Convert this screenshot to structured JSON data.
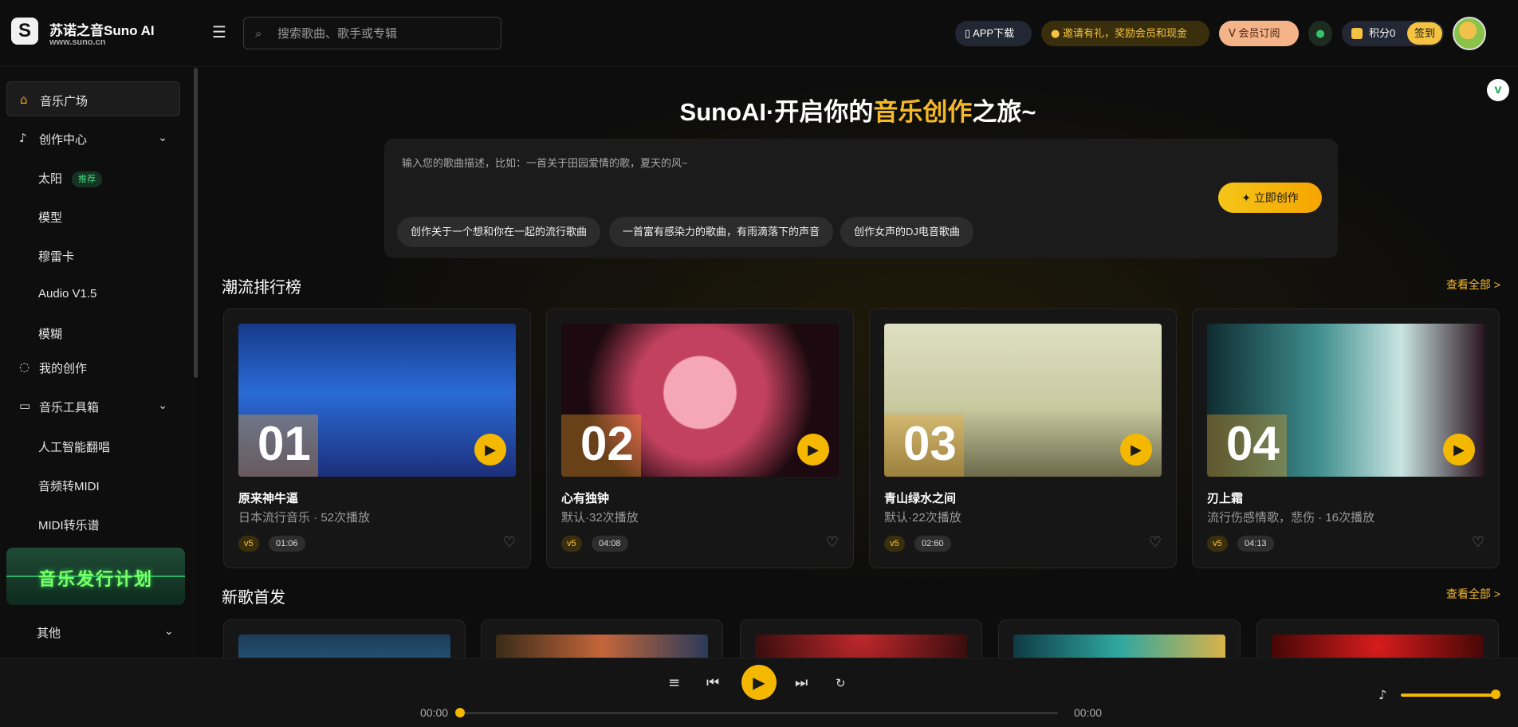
{
  "brand": {
    "name": "苏诺之音Suno AI",
    "domain": "www.suno.cn",
    "logo_letter": "S"
  },
  "header": {
    "search_placeholder": "搜索歌曲、歌手或专辑",
    "app_download": "APP下载",
    "invite": "邀请有礼，奖励会员和现金",
    "vip": "会员订阅",
    "points": "积分0",
    "sign_in": "签到"
  },
  "sidebar": {
    "music_plaza": "音乐广场",
    "creation_center": "创作中心",
    "creation_items": [
      {
        "label": "太阳",
        "badge": "推荐"
      },
      {
        "label": "模型"
      },
      {
        "label": "穆雷卡"
      },
      {
        "label": "Audio V1.5"
      },
      {
        "label": "模糊"
      }
    ],
    "my_creations": "我的创作",
    "toolbox": "音乐工具箱",
    "toolbox_items": [
      "人工智能翻唱",
      "音频转MIDI",
      "MIDI转乐谱"
    ],
    "promo": "音乐发行计划",
    "other": "其他"
  },
  "hero": {
    "title_pre": "SunoAI·开启你的",
    "title_hl": "音乐创作",
    "title_post": "之旅~",
    "prompt_placeholder": "输入您的歌曲描述，比如：一首关于田园爱情的歌，夏天的风~",
    "create_button": "立即创作",
    "chips": [
      "创作关于一个想和你在一起的流行歌曲",
      "一首富有感染力的歌曲，有雨滴落下的声音",
      "创作女声的DJ电音歌曲"
    ]
  },
  "trending": {
    "title": "潮流排行榜",
    "see_all": "查看全部 >",
    "cards": [
      {
        "rank": "01",
        "name": "原来神牛逼",
        "meta": "日本流行音乐 · 52次播放",
        "version": "v5",
        "duration": "01:06"
      },
      {
        "rank": "02",
        "name": "心有独钟",
        "meta": "默认·32次播放",
        "version": "v5",
        "duration": "04:08"
      },
      {
        "rank": "03",
        "name": "青山绿水之间",
        "meta": "默认·22次播放",
        "version": "v5",
        "duration": "02:60"
      },
      {
        "rank": "04",
        "name": "刃上霜",
        "meta": "流行伤感情歌，悲伤 · 16次播放",
        "version": "v5",
        "duration": "04:13"
      }
    ]
  },
  "new_releases": {
    "title": "新歌首发",
    "see_all": "查看全部 >"
  },
  "player": {
    "current_time": "00:00",
    "total_time": "00:00",
    "volume": 1.0,
    "progress": 0
  },
  "icons": {
    "menu": "☰",
    "search": "⌕",
    "play": "▶",
    "prev": "⏮",
    "next": "⏭",
    "heart": "♡"
  },
  "colors": {
    "accent": "#f5b800",
    "background": "#0b0b0b",
    "badge_green": "#48d67e"
  }
}
